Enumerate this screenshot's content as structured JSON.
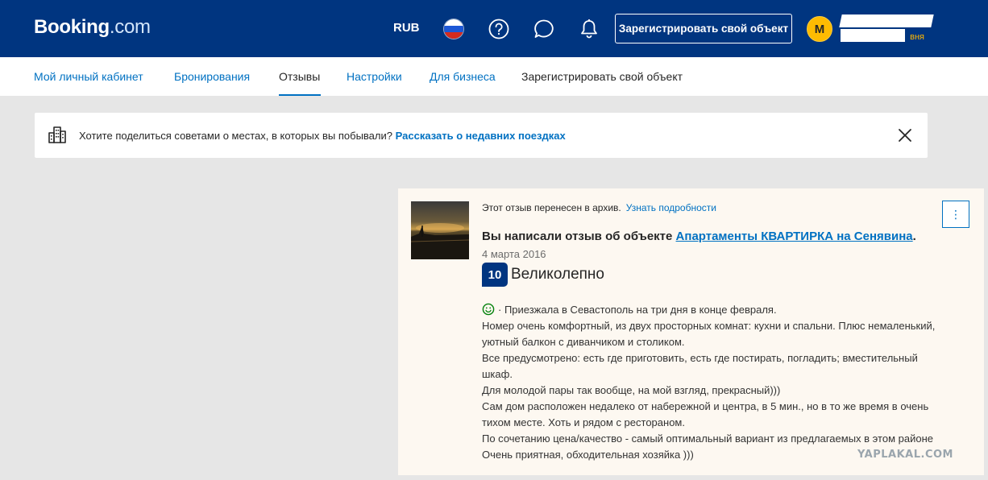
{
  "header": {
    "logo_main": "Booking",
    "logo_suffix": ".com",
    "currency": "RUB",
    "register_property": "Зарегистрировать свой объект",
    "avatar_letter": "M",
    "user_level": "вня",
    "icons": [
      "russia-flag-icon",
      "help-icon",
      "chat-icon",
      "bell-icon"
    ]
  },
  "nav": {
    "items": [
      {
        "label": "Мой личный кабинет"
      },
      {
        "label": "Бронирования"
      },
      {
        "label": "Отзывы",
        "active": true
      },
      {
        "label": "Настройки"
      },
      {
        "label": "Для бизнеса"
      },
      {
        "label": "Зарегистрировать свой объект"
      }
    ]
  },
  "banner": {
    "text": "Хотите поделиться советами о местах, в которых вы побывали?",
    "link": "Рассказать о недавних поездках"
  },
  "review": {
    "archived_text": "Этот отзыв перенесен в архив.",
    "learn_more": "Узнать подробности",
    "menu_glyph": "⋮",
    "title_prefix": "Вы написали отзыв об объекте",
    "property_name": "Апартаменты КВАРТИРКА на Сенявина",
    "title_suffix": ".",
    "date": "4 марта 2016",
    "score": "10",
    "score_label": "Великолепно",
    "lines": [
      "· Приезжала в Севастополь на три дня в конце февраля.",
      "Номер очень комфортный, из двух просторных комнат: кухни и спальни. Плюс немаленький,",
      "уютный балкон с диванчиком и столиком.",
      "Все предусмотрено: есть где приготовить, есть где постирать, погладить; вместительный",
      "шкаф.",
      "Для молодой пары так вообще, на мой взгляд, прекрасный)))",
      "Сам дом расположен недалеко от набережной и центра, в 5 мин., но в то же время в очень",
      "тихом месте. Хоть и рядом с рестораном.",
      "По сочетанию цена/качество - самый оптимальный вариант из предлагаемых в этом районе",
      "Очень приятная, обходительная хозяйка )))"
    ]
  },
  "watermark": "YAPLAKAL.COM",
  "colors": {
    "brand_dark": "#003580",
    "link": "#0071c2",
    "page_bg": "#e6e6e6",
    "card_bg": "#fdf8f1",
    "avatar": "#febb02"
  }
}
